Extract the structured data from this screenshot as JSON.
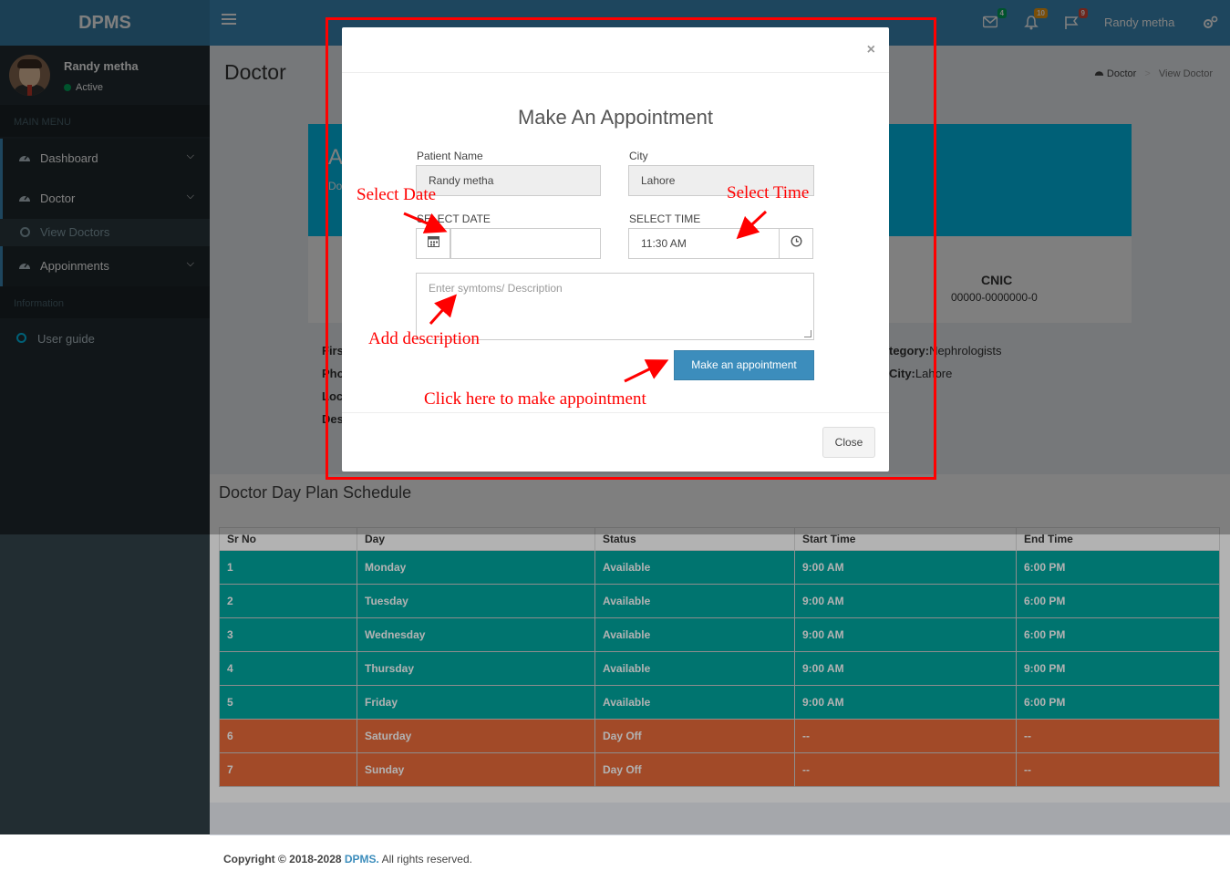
{
  "app": {
    "logo": "DPMS"
  },
  "header": {
    "badges": {
      "mail": "4",
      "bell": "10",
      "flag": "9"
    },
    "user_name": "Randy metha"
  },
  "sidebar": {
    "user_name": "Randy metha",
    "status": "Active",
    "main_menu_header": "MAIN MENU",
    "items": [
      {
        "label": "Dashboard"
      },
      {
        "label": "Doctor"
      },
      {
        "label": "View Doctors"
      },
      {
        "label": "Appoinments"
      }
    ],
    "info_header": "Information",
    "guide": "User guide"
  },
  "page": {
    "title": "Doctor",
    "breadcrumb": [
      "Doctor",
      "View Doctor"
    ],
    "banner_title": "A",
    "banner_sub": "Do",
    "cnic_label": "CNIC",
    "cnic_value": "00000-0000000-0",
    "details": {
      "first": "Firs",
      "phone": "Pho",
      "loc": "Loc",
      "desc": "Des",
      "category_label": "tegory:",
      "category_value": "Nephrologists",
      "city_label": "City:",
      "city_value": "Lahore"
    }
  },
  "schedule": {
    "title": "Doctor Day Plan Schedule",
    "columns": [
      "Sr No",
      "Day",
      "Status",
      "Start Time",
      "End Time"
    ],
    "rows": [
      [
        "1",
        "Monday",
        "Available",
        "9:00 AM",
        "6:00 PM"
      ],
      [
        "2",
        "Tuesday",
        "Available",
        "9:00 AM",
        "6:00 PM"
      ],
      [
        "3",
        "Wednesday",
        "Available",
        "9:00 AM",
        "6:00 PM"
      ],
      [
        "4",
        "Thursday",
        "Available",
        "9:00 AM",
        "9:00 PM"
      ],
      [
        "5",
        "Friday",
        "Available",
        "9:00 AM",
        "6:00 PM"
      ],
      [
        "6",
        "Saturday",
        "Day Off",
        "--",
        "--"
      ],
      [
        "7",
        "Sunday",
        "Day Off",
        "--",
        "--"
      ]
    ]
  },
  "modal": {
    "close_x": "×",
    "title": "Make An Appointment",
    "patient_label": "Patient Name",
    "patient_value": "Randy metha",
    "city_label": "City",
    "city_value": "Lahore",
    "date_label": "SELECT DATE",
    "date_value": "",
    "time_label": "SELECT TIME",
    "time_value": "11:30 AM",
    "desc_placeholder": "Enter symtoms/ Description",
    "submit": "Make an appointment",
    "close": "Close"
  },
  "annotations": {
    "date": "Select Date",
    "time": "Select Time",
    "desc": "Add description",
    "submit": "Click here to make appointment"
  },
  "footer": {
    "prefix": "Copyright © 2018-2028 ",
    "brand": "DPMS.",
    "suffix": " All rights reserved."
  },
  "colors": {
    "accent": "#3c8dbc",
    "available_row": "#00a7a0",
    "dayoff_row": "#e86b3a",
    "annotation": "#ff0000"
  }
}
